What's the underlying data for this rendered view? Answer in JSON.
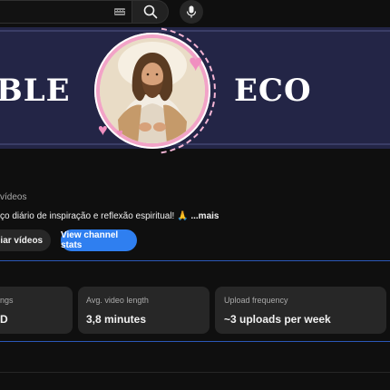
{
  "search": {
    "placeholder": ""
  },
  "icons": {
    "keyboard": "keyboard-icon",
    "search": "search-icon",
    "mic": "microphone-icon"
  },
  "banner": {
    "left_text": "BLE",
    "right_text": "ECO",
    "colors": {
      "background": "#232546",
      "accent": "#f08fc0"
    }
  },
  "channel": {
    "videos_text": "vídeos",
    "description": "ço diário de inspiração e reflexão espiritual! 🙏",
    "more_label": "...mais"
  },
  "buttons": {
    "manage_videos": "ciar vídeos",
    "view_stats": "View channel stats",
    "accent_color": "#2f7ff0"
  },
  "stats": {
    "cards": [
      {
        "label": "ngs",
        "value": "D"
      },
      {
        "label": "Avg. video length",
        "value": "3,8 minutes"
      },
      {
        "label": "Upload frequency",
        "value": "~3 uploads per week"
      }
    ]
  }
}
